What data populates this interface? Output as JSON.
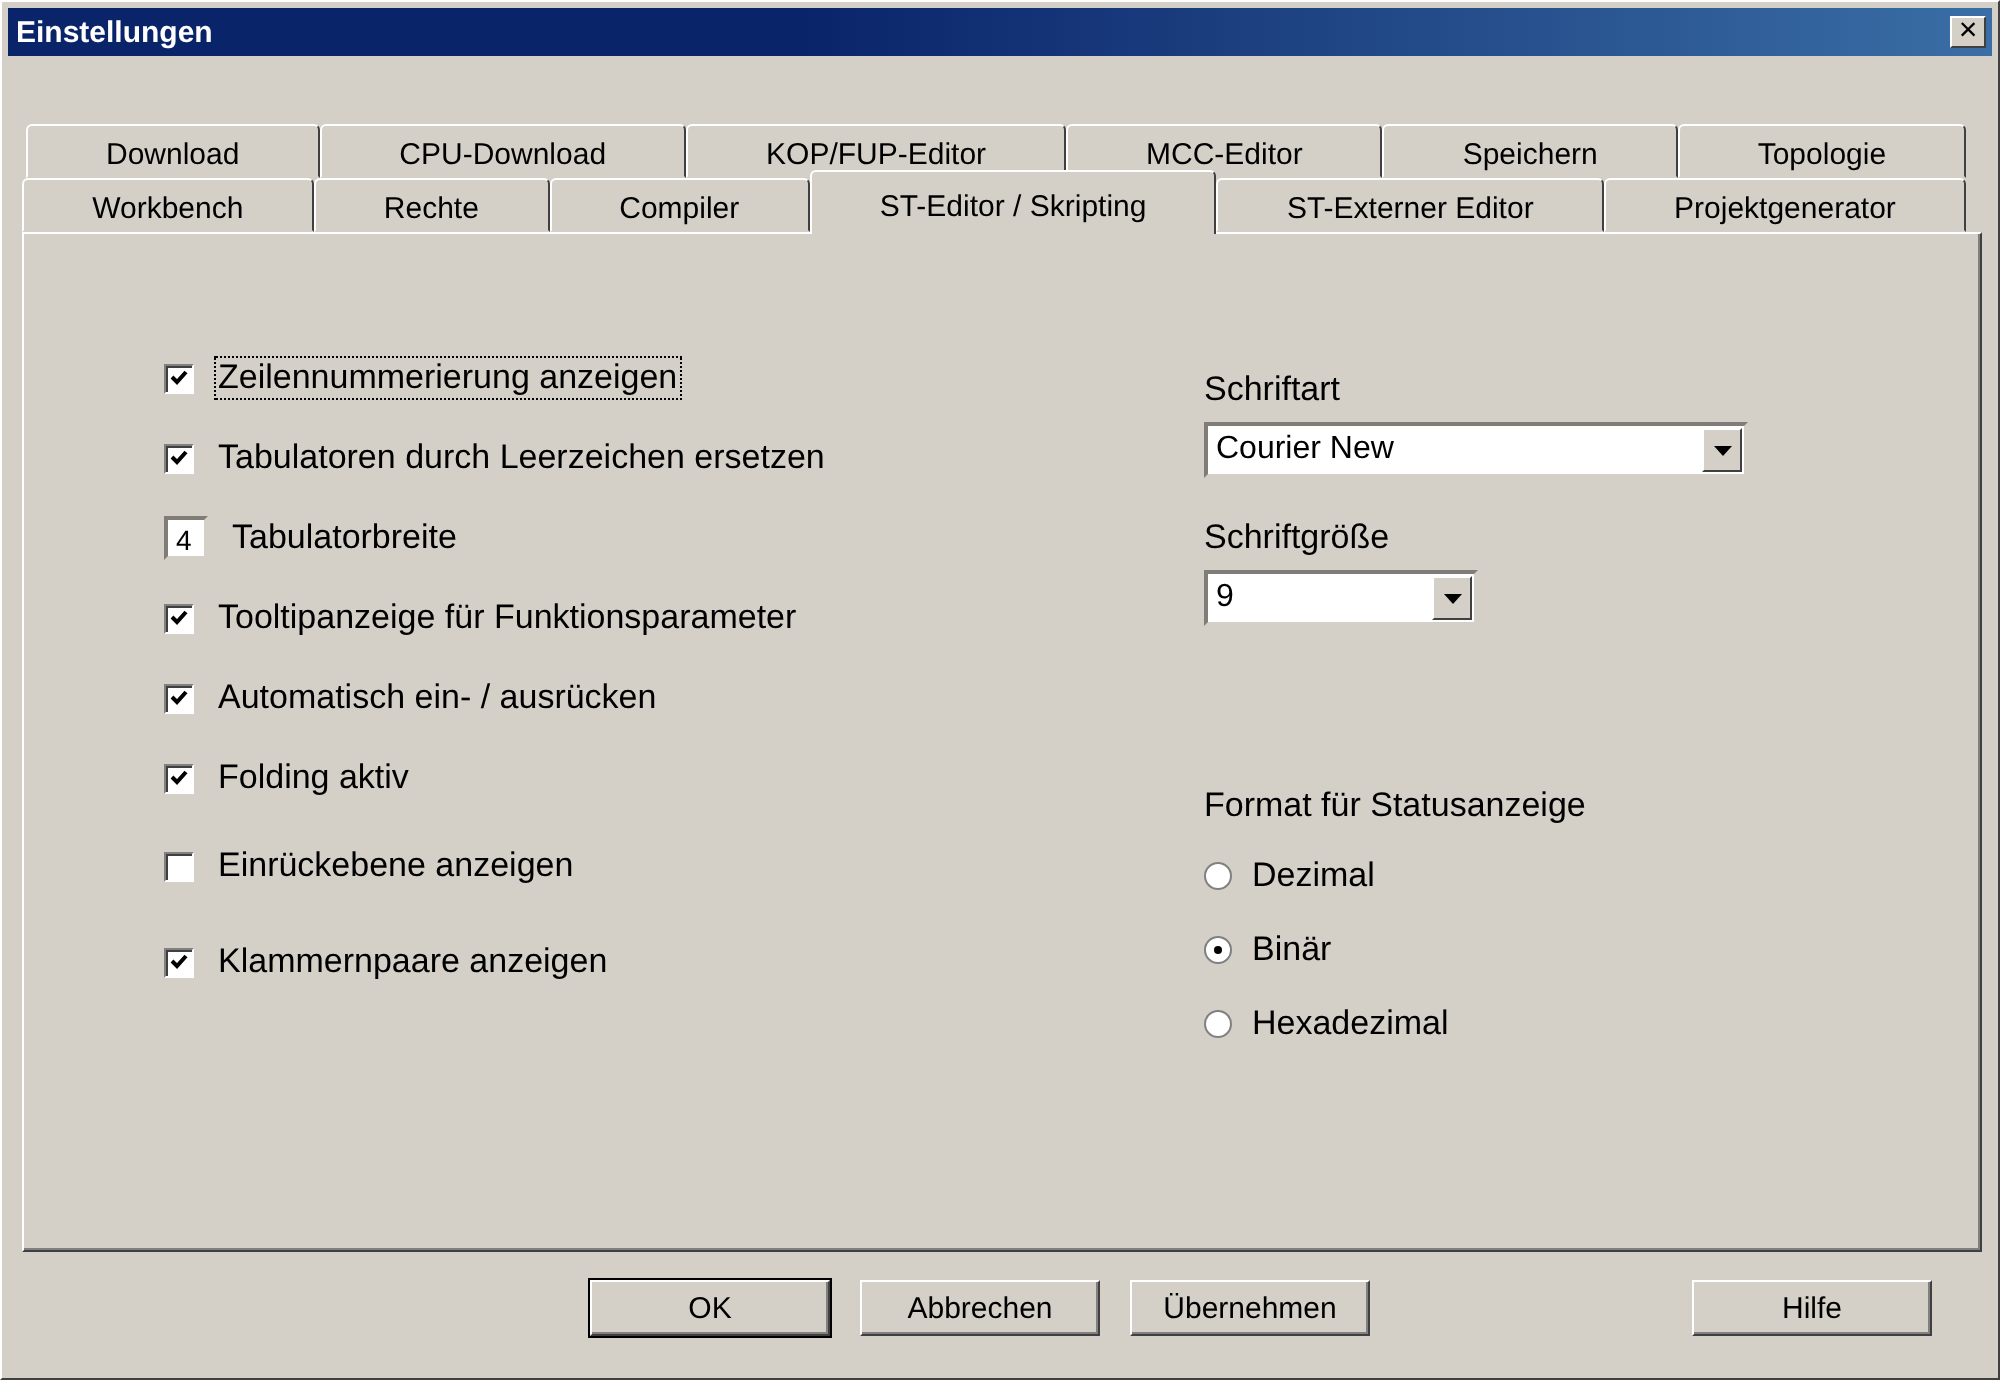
{
  "window": {
    "title": "Einstellungen",
    "close": "×"
  },
  "tab_rows": [
    [
      {
        "label": "Download",
        "selected": false
      },
      {
        "label": "CPU-Download",
        "selected": false
      },
      {
        "label": "KOP/FUP-Editor",
        "selected": false
      },
      {
        "label": "MCC-Editor",
        "selected": false
      },
      {
        "label": "Speichern",
        "selected": false
      },
      {
        "label": "Topologie",
        "selected": false
      }
    ],
    [
      {
        "label": "Workbench",
        "selected": false
      },
      {
        "label": "Rechte",
        "selected": false
      },
      {
        "label": "Compiler",
        "selected": false
      },
      {
        "label": "ST-Editor / Skripting",
        "selected": true
      },
      {
        "label": "ST-Externer Editor",
        "selected": false
      },
      {
        "label": "Projektgenerator",
        "selected": false
      }
    ]
  ],
  "options": [
    {
      "kind": "checkbox",
      "label": "Zeilennummerierung anzeigen",
      "checked": true,
      "focused": true
    },
    {
      "kind": "checkbox",
      "label": "Tabulatoren durch Leerzeichen ersetzen",
      "checked": true,
      "focused": false
    },
    {
      "kind": "number",
      "label": "Tabulatorbreite",
      "value": "4"
    },
    {
      "kind": "checkbox",
      "label": "Tooltipanzeige für Funktionsparameter",
      "checked": true,
      "focused": false
    },
    {
      "kind": "checkbox",
      "label": "Automatisch ein- / ausrücken",
      "checked": true,
      "focused": false
    },
    {
      "kind": "checkbox",
      "label": "Folding aktiv",
      "checked": true,
      "focused": false
    },
    {
      "kind": "checkbox",
      "label": "Einrückebene anzeigen",
      "checked": false,
      "focused": false
    },
    {
      "kind": "checkbox",
      "label": "Klammernpaare anzeigen",
      "checked": true,
      "focused": false
    }
  ],
  "font": {
    "label": "Schriftart",
    "value": "Courier New"
  },
  "font_size": {
    "label": "Schriftgröße",
    "value": "9"
  },
  "status_format": {
    "label": "Format für Statusanzeige",
    "choices": [
      {
        "label": "Dezimal",
        "selected": false
      },
      {
        "label": "Binär",
        "selected": true
      },
      {
        "label": "Hexadezimal",
        "selected": false
      }
    ]
  },
  "buttons": [
    {
      "label": "OK",
      "default": true
    },
    {
      "label": "Abbrechen",
      "default": false
    },
    {
      "label": "Übernehmen",
      "default": false
    },
    {
      "label": "Hilfe",
      "default": false
    }
  ]
}
